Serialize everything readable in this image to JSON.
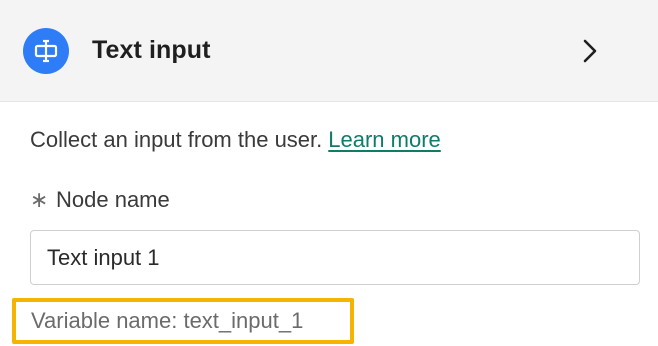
{
  "header": {
    "title": "Text input",
    "icon": "text-input-node-icon",
    "chevron_icon": "chevron-right-icon",
    "icon_color": "#2f7df6"
  },
  "body": {
    "description": "Collect an input from the user.",
    "learn_more_label": "Learn more"
  },
  "node_name": {
    "required_icon": "asterisk-icon",
    "label": "Node name",
    "value": "Text input 1"
  },
  "variable": {
    "text": "Variable name: text_input_1",
    "highlight_color": "#f5b400"
  },
  "colors": {
    "link": "#0f7c6b",
    "header_bg": "#f4f4f4"
  }
}
